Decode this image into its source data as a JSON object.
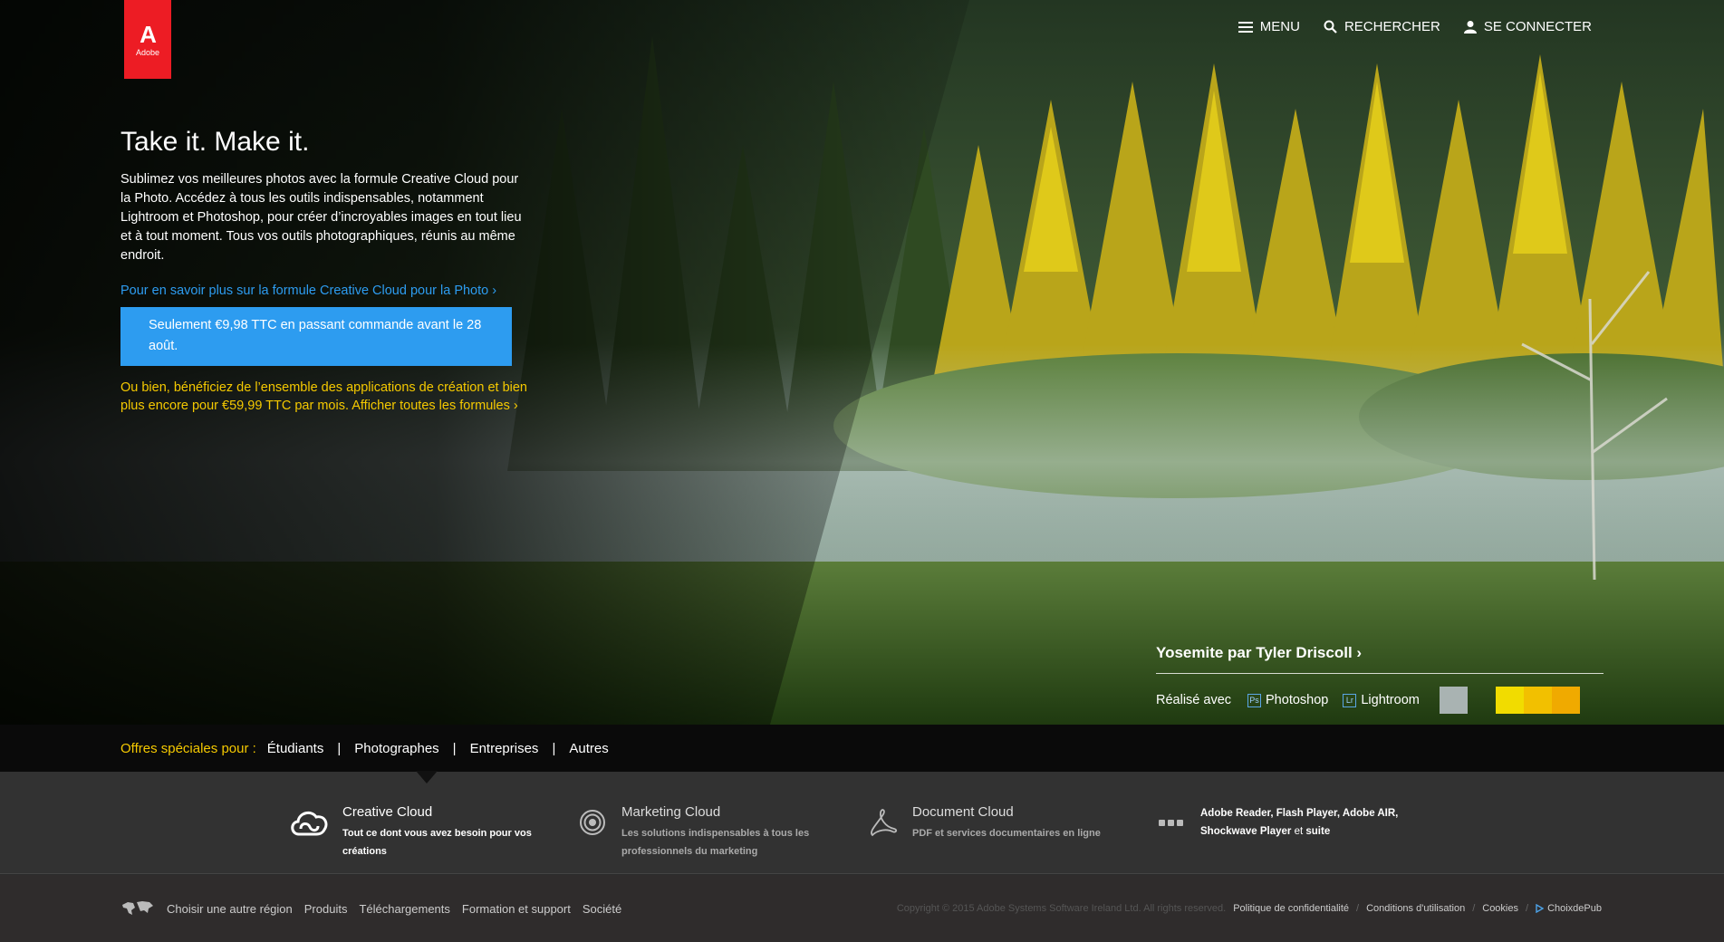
{
  "brand": {
    "logo_mark": "A",
    "logo_word": "Adobe",
    "accent": "#ed1c24"
  },
  "topnav": {
    "menu": "MENU",
    "search": "RECHERCHER",
    "login": "SE CONNECTER"
  },
  "hero": {
    "headline": "Take it. Make it.",
    "body": "Sublimez vos meilleures photos avec la formule Creative Cloud pour la Photo. Accédez à tous les outils indispensables, notamment Lightroom et Photoshop, pour créer d’incroyables images en tout lieu et à tout moment. Tous vos outils photographiques, réunis au même endroit.",
    "learn_link": "Pour en savoir plus sur la formule Creative Cloud pour la Photo ›",
    "cta": "Seulement €9,98 TTC en passant commande avant le 28 août.",
    "alt_offer": "Ou bien, bénéficiez de l’ensemble des applications de création et bien plus encore pour €59,99 TTC par mois. Afficher toutes les formules ›",
    "link_color": "#2d9cf0",
    "offer_color": "#f5c900"
  },
  "credit": {
    "title": "Yosemite par Tyler Driscoll ›",
    "made_with": "Réalisé avec",
    "apps": [
      {
        "badge": "Ps",
        "name": "Photoshop"
      },
      {
        "badge": "Lr",
        "name": "Lightroom"
      }
    ],
    "swatches": [
      "#a9b3b2",
      "#1e1f0e",
      "#f1dc00",
      "#f2c000",
      "#f0aa00"
    ]
  },
  "offers": {
    "label": "Offres spéciales pour :",
    "items": [
      "Étudiants",
      "Photographes",
      "Entreprises",
      "Autres"
    ]
  },
  "clouds": [
    {
      "title": "Creative Cloud",
      "desc": "Tout ce dont vous avez besoin pour vos créations",
      "icon": "creative-cloud-icon"
    },
    {
      "title": "Marketing Cloud",
      "desc": "Les solutions indispensables à tous les professionnels du marketing",
      "icon": "marketing-cloud-icon"
    },
    {
      "title": "Document Cloud",
      "desc": "PDF et services documentaires en ligne",
      "icon": "document-cloud-icon"
    }
  ],
  "misc_products": {
    "reader": "Adobe Reader",
    "flash": "Flash Player",
    "air": "Adobe AIR",
    "shockwave": "Shockwave Player",
    "and": "et",
    "suite": "suite"
  },
  "footer": {
    "region": "Choisir une autre région",
    "links": [
      "Produits",
      "Téléchargements",
      "Formation et support",
      "Société"
    ],
    "copyright": "Copyright © 2015 Adobe Systems Software Ireland Ltd. All rights reserved.",
    "legal": [
      "Politique de confidentialité",
      "Conditions d'utilisation",
      "Cookies"
    ],
    "adchoice": "ChoixdePub"
  }
}
